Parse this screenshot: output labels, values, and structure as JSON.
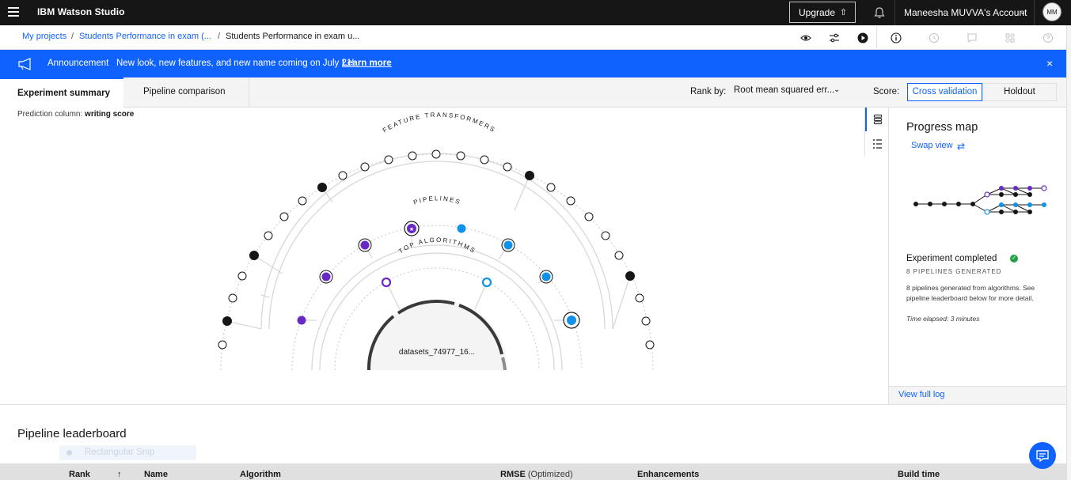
{
  "topbar": {
    "brand": "IBM Watson Studio",
    "upgrade_label": "Upgrade",
    "account_label": "Maneesha MUVVA's Account",
    "avatar_initials": "MM"
  },
  "breadcrumb": {
    "items": [
      "My projects",
      "Students Performance in exam (...",
      "Students Performance in exam u..."
    ]
  },
  "announcement": {
    "label": "Announcement",
    "message": "New look, new features, and new name coming on July 21!",
    "link": "Learn more"
  },
  "tabs": {
    "active": "Experiment summary",
    "inactive": "Pipeline comparison"
  },
  "rank": {
    "label": "Rank by:",
    "value": "Root mean squared err..."
  },
  "score": {
    "label": "Score:",
    "options": [
      "Cross validation",
      "Holdout"
    ],
    "selected": "Cross validation"
  },
  "main": {
    "prediction_label": "Prediction column:",
    "prediction_value": "writing score"
  },
  "viz": {
    "ring_labels": [
      "FEATURE TRANSFORMERS",
      "PIPELINES",
      "TOP ALGORITHMS"
    ],
    "dataset": "datasets_74977_16..."
  },
  "progress_map": {
    "title": "Progress map",
    "swap_view": "Swap view",
    "status": "Experiment completed",
    "count": "8 PIPELINES GENERATED",
    "description": "8 pipelines generated from algorithms. See pipeline leaderboard below for more detail.",
    "elapsed": "Time elapsed: 3 minutes",
    "footer_link": "View full log"
  },
  "leaderboard": {
    "title": "Pipeline leaderboard",
    "snip_overlay": "Rectangular Snip",
    "columns": [
      "Rank",
      "Name",
      "Algorithm",
      "RMSE",
      "Enhancements",
      "Build time"
    ],
    "rmse_suffix": "(Optimized)"
  },
  "colors": {
    "brand_blue": "#0f62fe",
    "purple": "#6929c4",
    "cyan": "#1192e8",
    "topbar": "#161616"
  }
}
